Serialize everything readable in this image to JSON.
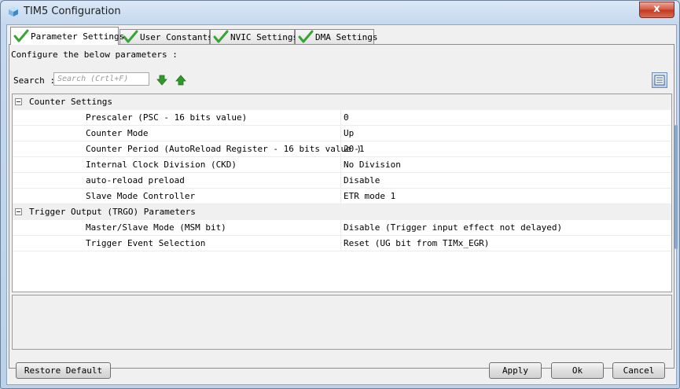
{
  "window": {
    "title": "TIM5 Configuration",
    "close_label": "x"
  },
  "tabs": [
    {
      "label": "Parameter Settings",
      "active": true
    },
    {
      "label": "User Constants",
      "active": false
    },
    {
      "label": "NVIC Settings",
      "active": false
    },
    {
      "label": "DMA Settings",
      "active": false
    }
  ],
  "panel": {
    "info_text": "Configure the below parameters :",
    "search_label": "Search :",
    "search_placeholder": "Search (Crtl+F)",
    "search_value": ""
  },
  "groups": [
    {
      "label": "Counter Settings",
      "rows": [
        {
          "name": "Prescaler (PSC - 16 bits value)",
          "value": "0"
        },
        {
          "name": "Counter Mode",
          "value": "Up"
        },
        {
          "name": "Counter Period (AutoReload Register - 16 bits value )",
          "value": "20-1"
        },
        {
          "name": "Internal Clock Division (CKD)",
          "value": "No Division"
        },
        {
          "name": "auto-reload preload",
          "value": "Disable"
        },
        {
          "name": "Slave Mode Controller",
          "value": "ETR mode 1"
        }
      ]
    },
    {
      "label": "Trigger Output (TRGO) Parameters",
      "rows": [
        {
          "name": "Master/Slave Mode (MSM bit)",
          "value": "Disable (Trigger input effect not delayed)"
        },
        {
          "name": "Trigger Event Selection",
          "value": "Reset (UG bit from TIMx_EGR)"
        }
      ]
    }
  ],
  "buttons": {
    "restore": "Restore Default",
    "apply": "Apply",
    "ok": "Ok",
    "cancel": "Cancel"
  },
  "colors": {
    "check_green": "#3aa335",
    "arrow_green": "#2f9a2a",
    "close_red": "#c8442a"
  }
}
